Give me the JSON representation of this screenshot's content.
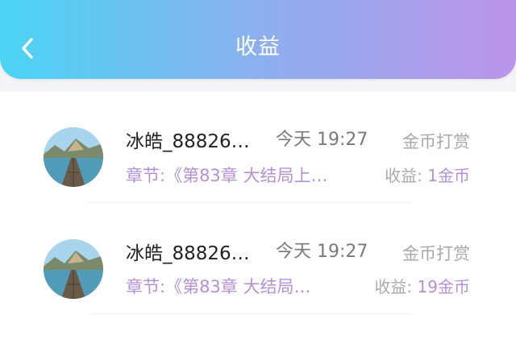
{
  "header": {
    "title": "收益",
    "back_icon": "chevron-left-icon",
    "gradient": [
      "#4ad4f4",
      "#bd94ea"
    ]
  },
  "records": [
    {
      "name": "冰皓_88826…",
      "time": "今天 19:27",
      "type": "金币打赏",
      "chapter": "章节:《第83章 大结局上…",
      "earn_label": "收益:",
      "earn_value": "1金币"
    },
    {
      "name": "冰皓_88826…",
      "time": "今天 19:27",
      "type": "金币打赏",
      "chapter": "章节:《第83章 大结局…",
      "earn_label": "收益:",
      "earn_value": "19金币"
    }
  ],
  "colors": {
    "accent": "#b58fd8",
    "muted": "#a9a9a9"
  }
}
